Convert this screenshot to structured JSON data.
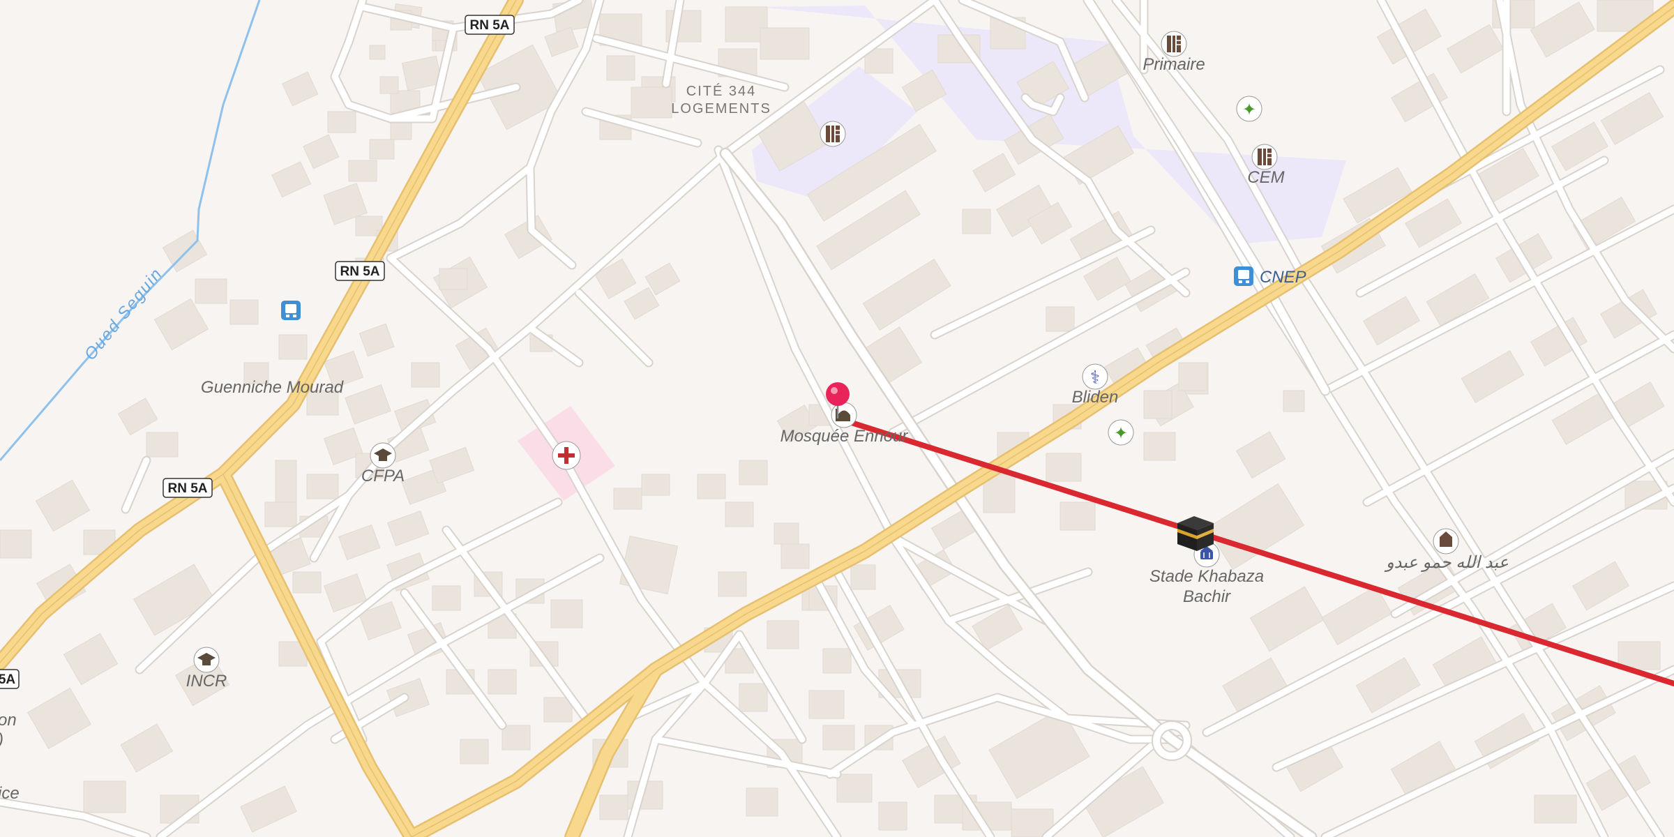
{
  "map": {
    "roads": {
      "rn5a_labels": [
        "RN 5A",
        "RN 5A",
        "RN 5A",
        "5A"
      ]
    },
    "water": {
      "name": "Oued Seguin"
    },
    "districts": {
      "cite_line1": "CITÉ 344",
      "cite_line2": "LOGEMENTS"
    },
    "places": {
      "primaire": "Primaire",
      "cem": "CEM",
      "cnep": "CNEP",
      "bliden": "Bliden",
      "guenniche": "Guenniche Mourad",
      "cfpa": "CFPA",
      "incr": "INCR",
      "mosquee": "Mosquée Ennour",
      "stade_line1": "Stade Khabaza",
      "stade_line2": "Bachir",
      "arabic": "عبد الله حمو عبدو",
      "edge_on": "on",
      "edge_paren": ")",
      "edge_ice": "ice"
    },
    "icons": {
      "school": "school-icon",
      "sport": "sports-icon",
      "bus": "bus-stop-icon",
      "pharmacy": "pharmacy-icon",
      "hospital": "hospital-icon",
      "university": "education-icon",
      "mosque": "mosque-icon",
      "stadium": "stadium-icon",
      "kaaba": "kaaba-icon",
      "pin": "location-pin-icon"
    },
    "colors": {
      "background": "#f7f4f1",
      "building": "#ebe4dd",
      "road_casing": "#d9d3cd",
      "road_fill": "#ffffff",
      "highway": "#f8d88c",
      "school_area": "#ece8fa",
      "hospital_area": "#fbdde8",
      "water": "#8ec1ec",
      "route_line": "#d9282f",
      "pin": "#e8245a"
    }
  }
}
